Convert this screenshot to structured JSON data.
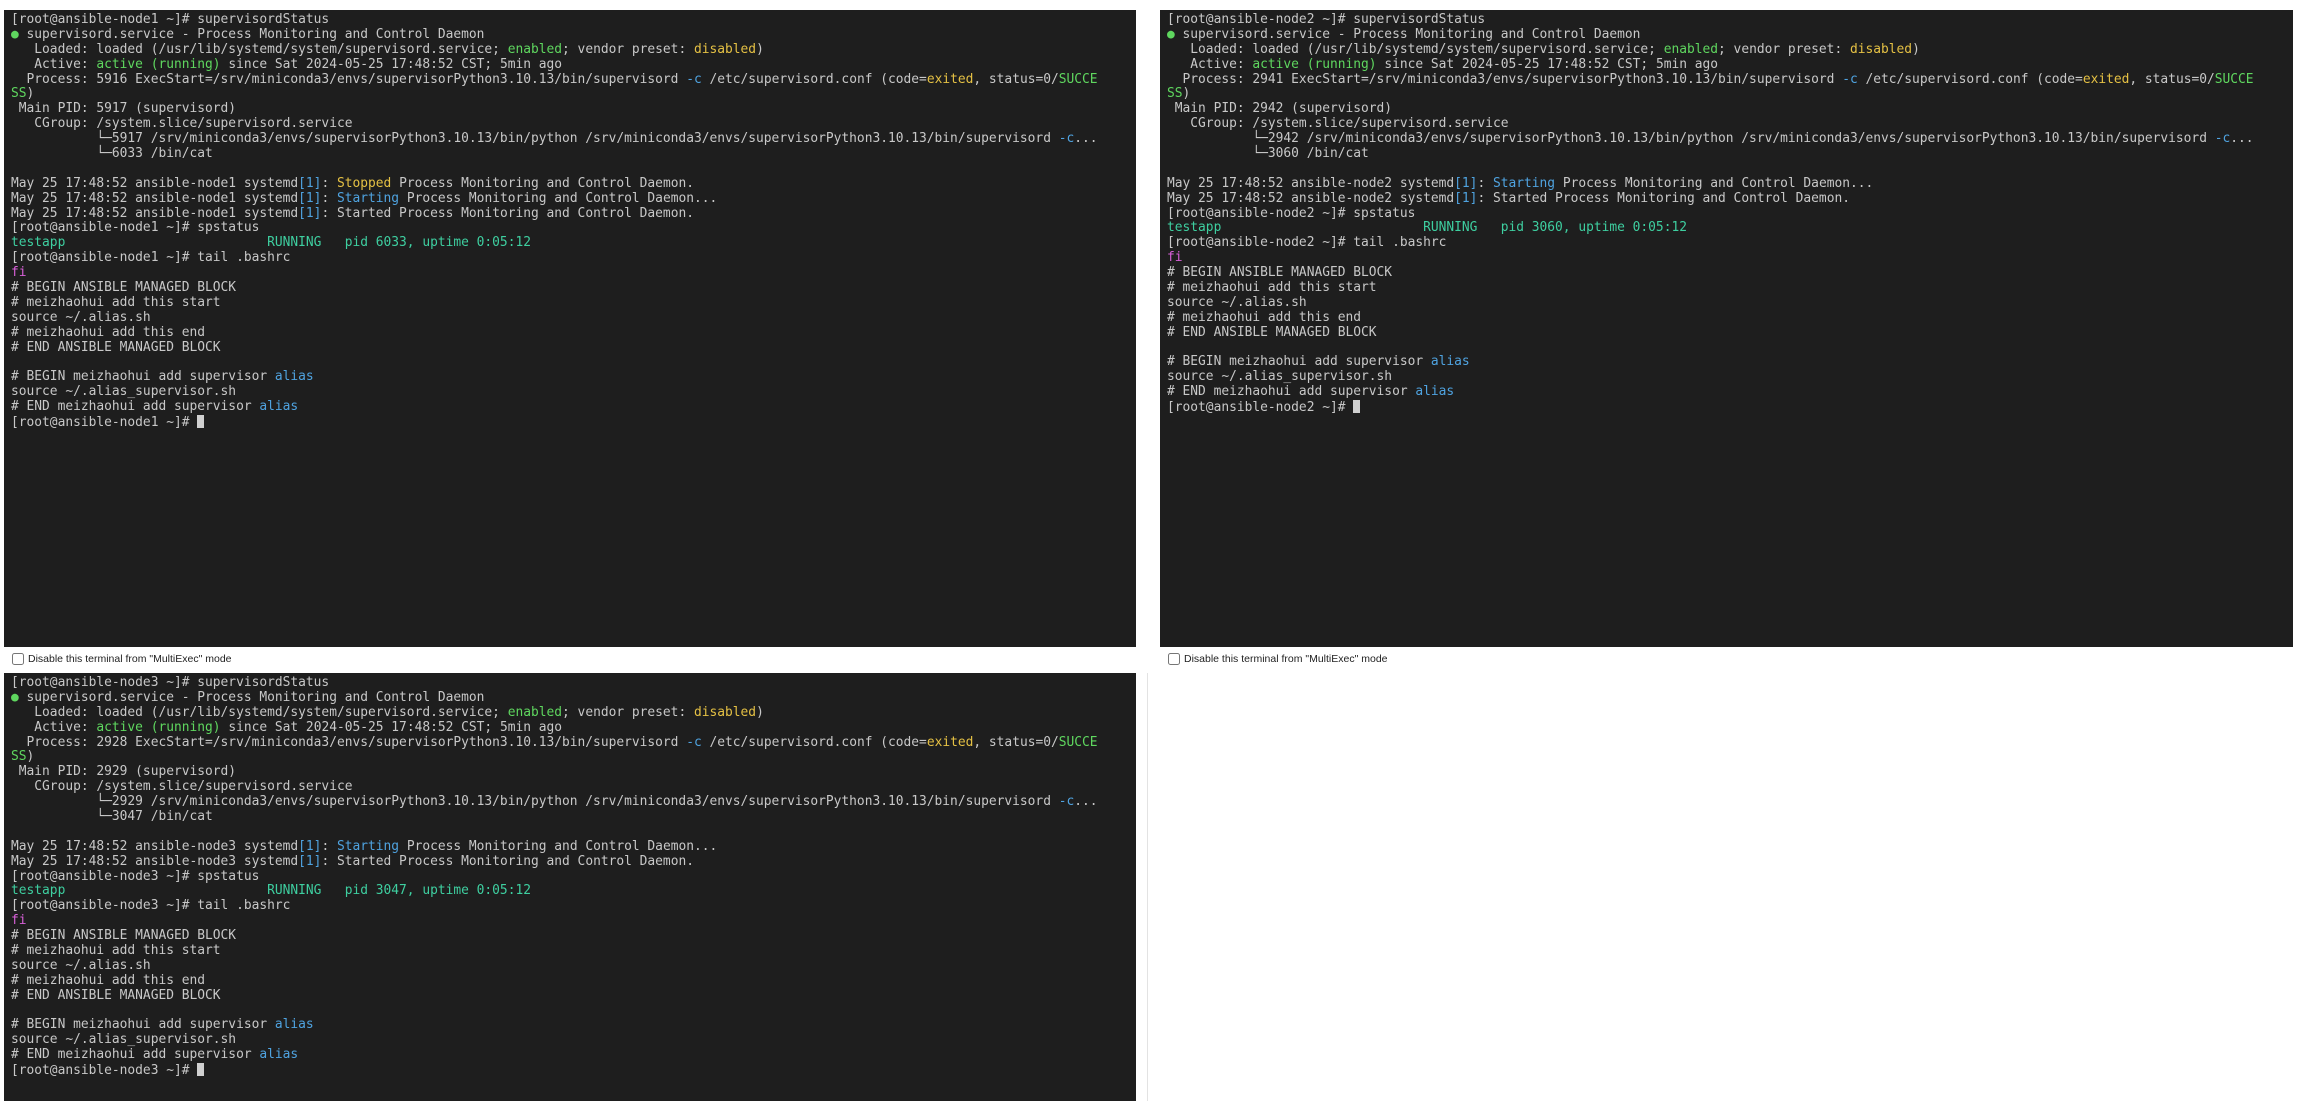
{
  "terminals": [
    {
      "node": "ansible-node1",
      "multiexec_label": "Disable this terminal from \"MultiExec\" mode",
      "lines": [
        [
          {
            "t": "[root@ansible-node1 ~]# supervisordStatus"
          }
        ],
        [
          {
            "t": "●",
            "c": "g"
          },
          {
            "t": " supervisord.service - Process Monitoring and Control Daemon"
          }
        ],
        [
          {
            "t": "   Loaded: loaded (/usr/lib/systemd/system/supervisord.service; "
          },
          {
            "t": "enabled",
            "c": "g"
          },
          {
            "t": "; vendor preset: "
          },
          {
            "t": "disabled",
            "c": "y"
          },
          {
            "t": ")"
          }
        ],
        [
          {
            "t": "   Active: "
          },
          {
            "t": "active (running)",
            "c": "g"
          },
          {
            "t": " since Sat 2024-05-25 17:48:52 CST; 5min ago"
          }
        ],
        [
          {
            "t": "  Process: 5916 ExecStart=/srv/miniconda3/envs/supervisorPython3.10.13/bin/supervisord "
          },
          {
            "t": "-c",
            "c": "b"
          },
          {
            "t": " /etc/supervisord.conf (code="
          },
          {
            "t": "exited",
            "c": "y"
          },
          {
            "t": ", status=0/"
          },
          {
            "t": "SUCCE",
            "c": "g"
          }
        ],
        [
          {
            "t": "SS",
            "c": "g"
          },
          {
            "t": ")"
          }
        ],
        [
          {
            "t": " Main PID: 5917 (supervisord)"
          }
        ],
        [
          {
            "t": "   CGroup: /system.slice/supervisord.service"
          }
        ],
        [
          {
            "t": "           └─5917 /srv/miniconda3/envs/supervisorPython3.10.13/bin/python /srv/miniconda3/envs/supervisorPython3.10.13/bin/supervisord "
          },
          {
            "t": "-c",
            "c": "b"
          },
          {
            "t": "..."
          }
        ],
        [
          {
            "t": "           └─6033 /bin/cat"
          }
        ],
        [
          {
            "t": ""
          }
        ],
        [
          {
            "t": "May 25 17:48:52 ansible-node1 systemd"
          },
          {
            "t": "[1]",
            "c": "b"
          },
          {
            "t": ": "
          },
          {
            "t": "Stopped",
            "c": "y"
          },
          {
            "t": " Process Monitoring and Control Daemon."
          }
        ],
        [
          {
            "t": "May 25 17:48:52 ansible-node1 systemd"
          },
          {
            "t": "[1]",
            "c": "b"
          },
          {
            "t": ": "
          },
          {
            "t": "Starting",
            "c": "b"
          },
          {
            "t": " Process Monitoring and Control Daemon..."
          }
        ],
        [
          {
            "t": "May 25 17:48:52 ansible-node1 systemd"
          },
          {
            "t": "[1]",
            "c": "b"
          },
          {
            "t": ": Started Process Monitoring and Control Daemon."
          }
        ],
        [
          {
            "t": "[root@ansible-node1 ~]# spstatus"
          }
        ],
        [
          {
            "t": "testapp                          RUNNING   pid 6033, uptime 0:05:12",
            "c": "tl"
          }
        ],
        [
          {
            "t": "[root@ansible-node1 ~]# tail .bashrc"
          }
        ],
        [
          {
            "t": "fi",
            "c": "m"
          }
        ],
        [
          {
            "t": "# BEGIN ANSIBLE MANAGED BLOCK"
          }
        ],
        [
          {
            "t": "# meizhaohui add this start"
          }
        ],
        [
          {
            "t": "source ~/.alias.sh"
          }
        ],
        [
          {
            "t": "# meizhaohui add this end"
          }
        ],
        [
          {
            "t": "# END ANSIBLE MANAGED BLOCK"
          }
        ],
        [
          {
            "t": ""
          }
        ],
        [
          {
            "t": "# BEGIN meizhaohui add supervisor "
          },
          {
            "t": "alias",
            "c": "b"
          }
        ],
        [
          {
            "t": "source ~/.alias_supervisor.sh"
          }
        ],
        [
          {
            "t": "# END meizhaohui add supervisor "
          },
          {
            "t": "alias",
            "c": "b"
          }
        ],
        [
          {
            "t": "[root@ansible-node1 ~]# "
          },
          {
            "cursor": true
          }
        ]
      ]
    },
    {
      "node": "ansible-node2",
      "multiexec_label": "Disable this terminal from \"MultiExec\" mode",
      "lines": [
        [
          {
            "t": "[root@ansible-node2 ~]# supervisordStatus"
          }
        ],
        [
          {
            "t": "●",
            "c": "g"
          },
          {
            "t": " supervisord.service - Process Monitoring and Control Daemon"
          }
        ],
        [
          {
            "t": "   Loaded: loaded (/usr/lib/systemd/system/supervisord.service; "
          },
          {
            "t": "enabled",
            "c": "g"
          },
          {
            "t": "; vendor preset: "
          },
          {
            "t": "disabled",
            "c": "y"
          },
          {
            "t": ")"
          }
        ],
        [
          {
            "t": "   Active: "
          },
          {
            "t": "active (running)",
            "c": "g"
          },
          {
            "t": " since Sat 2024-05-25 17:48:52 CST; 5min ago"
          }
        ],
        [
          {
            "t": "  Process: 2941 ExecStart=/srv/miniconda3/envs/supervisorPython3.10.13/bin/supervisord "
          },
          {
            "t": "-c",
            "c": "b"
          },
          {
            "t": " /etc/supervisord.conf (code="
          },
          {
            "t": "exited",
            "c": "y"
          },
          {
            "t": ", status=0/"
          },
          {
            "t": "SUCCE",
            "c": "g"
          }
        ],
        [
          {
            "t": "SS",
            "c": "g"
          },
          {
            "t": ")"
          }
        ],
        [
          {
            "t": " Main PID: 2942 (supervisord)"
          }
        ],
        [
          {
            "t": "   CGroup: /system.slice/supervisord.service"
          }
        ],
        [
          {
            "t": "           └─2942 /srv/miniconda3/envs/supervisorPython3.10.13/bin/python /srv/miniconda3/envs/supervisorPython3.10.13/bin/supervisord "
          },
          {
            "t": "-c",
            "c": "b"
          },
          {
            "t": "..."
          }
        ],
        [
          {
            "t": "           └─3060 /bin/cat"
          }
        ],
        [
          {
            "t": ""
          }
        ],
        [
          {
            "t": "May 25 17:48:52 ansible-node2 systemd"
          },
          {
            "t": "[1]",
            "c": "b"
          },
          {
            "t": ": "
          },
          {
            "t": "Starting",
            "c": "b"
          },
          {
            "t": " Process Monitoring and Control Daemon..."
          }
        ],
        [
          {
            "t": "May 25 17:48:52 ansible-node2 systemd"
          },
          {
            "t": "[1]",
            "c": "b"
          },
          {
            "t": ": Started Process Monitoring and Control Daemon."
          }
        ],
        [
          {
            "t": "[root@ansible-node2 ~]# spstatus"
          }
        ],
        [
          {
            "t": "testapp                          RUNNING   pid 3060, uptime 0:05:12",
            "c": "tl"
          }
        ],
        [
          {
            "t": "[root@ansible-node2 ~]# tail .bashrc"
          }
        ],
        [
          {
            "t": "fi",
            "c": "m"
          }
        ],
        [
          {
            "t": "# BEGIN ANSIBLE MANAGED BLOCK"
          }
        ],
        [
          {
            "t": "# meizhaohui add this start"
          }
        ],
        [
          {
            "t": "source ~/.alias.sh"
          }
        ],
        [
          {
            "t": "# meizhaohui add this end"
          }
        ],
        [
          {
            "t": "# END ANSIBLE MANAGED BLOCK"
          }
        ],
        [
          {
            "t": ""
          }
        ],
        [
          {
            "t": "# BEGIN meizhaohui add supervisor "
          },
          {
            "t": "alias",
            "c": "b"
          }
        ],
        [
          {
            "t": "source ~/.alias_supervisor.sh"
          }
        ],
        [
          {
            "t": "# END meizhaohui add supervisor "
          },
          {
            "t": "alias",
            "c": "b"
          }
        ],
        [
          {
            "t": "[root@ansible-node2 ~]# "
          },
          {
            "cursor": true
          }
        ]
      ]
    },
    {
      "node": "ansible-node3",
      "lines": [
        [
          {
            "t": "[root@ansible-node3 ~]# supervisordStatus"
          }
        ],
        [
          {
            "t": "●",
            "c": "g"
          },
          {
            "t": " supervisord.service - Process Monitoring and Control Daemon"
          }
        ],
        [
          {
            "t": "   Loaded: loaded (/usr/lib/systemd/system/supervisord.service; "
          },
          {
            "t": "enabled",
            "c": "g"
          },
          {
            "t": "; vendor preset: "
          },
          {
            "t": "disabled",
            "c": "y"
          },
          {
            "t": ")"
          }
        ],
        [
          {
            "t": "   Active: "
          },
          {
            "t": "active (running)",
            "c": "g"
          },
          {
            "t": " since Sat 2024-05-25 17:48:52 CST; 5min ago"
          }
        ],
        [
          {
            "t": "  Process: 2928 ExecStart=/srv/miniconda3/envs/supervisorPython3.10.13/bin/supervisord "
          },
          {
            "t": "-c",
            "c": "b"
          },
          {
            "t": " /etc/supervisord.conf (code="
          },
          {
            "t": "exited",
            "c": "y"
          },
          {
            "t": ", status=0/"
          },
          {
            "t": "SUCCE",
            "c": "g"
          }
        ],
        [
          {
            "t": "SS",
            "c": "g"
          },
          {
            "t": ")"
          }
        ],
        [
          {
            "t": " Main PID: 2929 (supervisord)"
          }
        ],
        [
          {
            "t": "   CGroup: /system.slice/supervisord.service"
          }
        ],
        [
          {
            "t": "           └─2929 /srv/miniconda3/envs/supervisorPython3.10.13/bin/python /srv/miniconda3/envs/supervisorPython3.10.13/bin/supervisord "
          },
          {
            "t": "-c",
            "c": "b"
          },
          {
            "t": "..."
          }
        ],
        [
          {
            "t": "           └─3047 /bin/cat"
          }
        ],
        [
          {
            "t": ""
          }
        ],
        [
          {
            "t": "May 25 17:48:52 ansible-node3 systemd"
          },
          {
            "t": "[1]",
            "c": "b"
          },
          {
            "t": ": "
          },
          {
            "t": "Starting",
            "c": "b"
          },
          {
            "t": " Process Monitoring and Control Daemon..."
          }
        ],
        [
          {
            "t": "May 25 17:48:52 ansible-node3 systemd"
          },
          {
            "t": "[1]",
            "c": "b"
          },
          {
            "t": ": Started Process Monitoring and Control Daemon."
          }
        ],
        [
          {
            "t": "[root@ansible-node3 ~]# spstatus"
          }
        ],
        [
          {
            "t": "testapp                          RUNNING   pid 3047, uptime 0:05:12",
            "c": "tl"
          }
        ],
        [
          {
            "t": "[root@ansible-node3 ~]# tail .bashrc"
          }
        ],
        [
          {
            "t": "fi",
            "c": "m"
          }
        ],
        [
          {
            "t": "# BEGIN ANSIBLE MANAGED BLOCK"
          }
        ],
        [
          {
            "t": "# meizhaohui add this start"
          }
        ],
        [
          {
            "t": "source ~/.alias.sh"
          }
        ],
        [
          {
            "t": "# meizhaohui add this end"
          }
        ],
        [
          {
            "t": "# END ANSIBLE MANAGED BLOCK"
          }
        ],
        [
          {
            "t": ""
          }
        ],
        [
          {
            "t": "# BEGIN meizhaohui add supervisor "
          },
          {
            "t": "alias",
            "c": "b"
          }
        ],
        [
          {
            "t": "source ~/.alias_supervisor.sh"
          }
        ],
        [
          {
            "t": "# END meizhaohui add supervisor "
          },
          {
            "t": "alias",
            "c": "b"
          }
        ],
        [
          {
            "t": "[root@ansible-node3 ~]# "
          },
          {
            "cursor": true
          }
        ]
      ]
    }
  ],
  "colors": {
    "terminal_bg": "#1e1e1e",
    "text": "#c8c8c8",
    "green": "#5fd75f",
    "yellow": "#e5c144",
    "blue": "#4fa3e0",
    "magenta": "#d75fd7",
    "teal": "#3ecfa0"
  }
}
